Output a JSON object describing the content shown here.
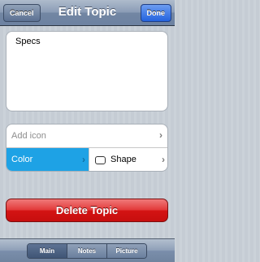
{
  "navbar": {
    "title": "Edit Topic",
    "cancel_label": "Cancel",
    "done_label": "Done"
  },
  "topic": {
    "text": "Specs"
  },
  "fields": {
    "add_icon_label": "Add icon",
    "color_label": "Color",
    "shape_label": "Shape",
    "color_value": "#1ea2e5"
  },
  "delete_label": "Delete Topic",
  "tabs": [
    {
      "label": "Main",
      "selected": true
    },
    {
      "label": "Notes",
      "selected": false
    },
    {
      "label": "Picture",
      "selected": false
    }
  ]
}
